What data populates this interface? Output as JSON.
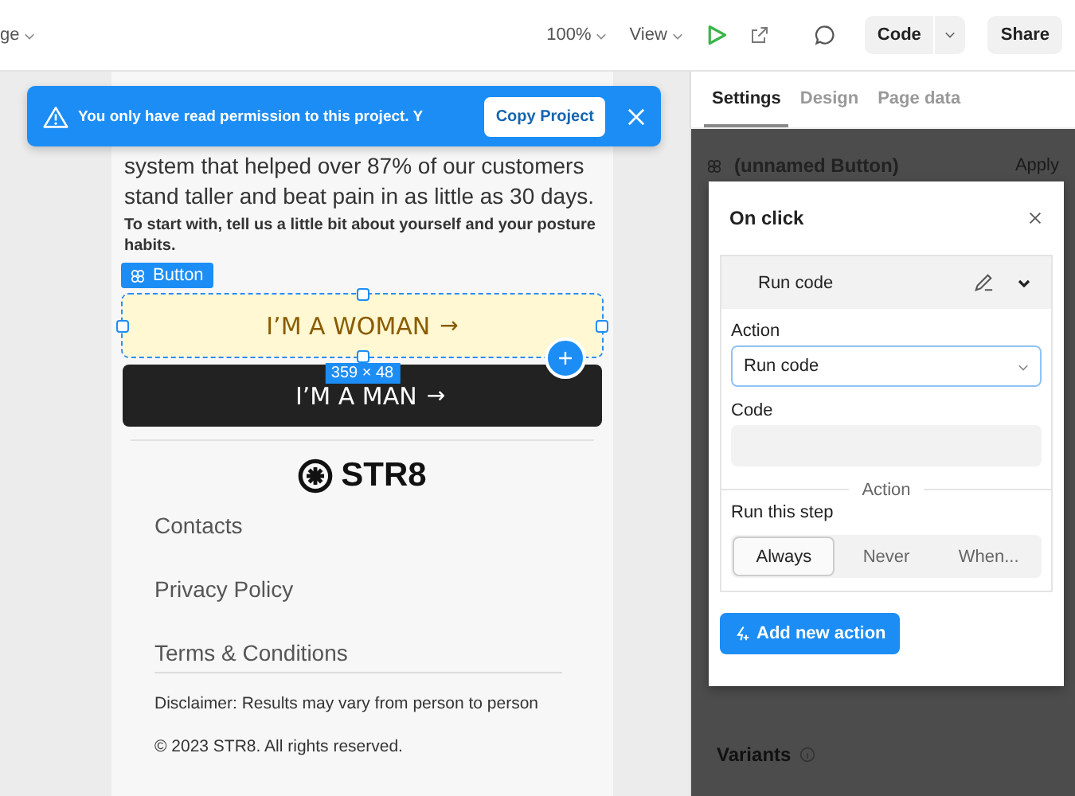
{
  "toolbar": {
    "page_menu": "ge",
    "zoom": "100%",
    "view": "View",
    "code_button": "Code",
    "share_button": "Share"
  },
  "banner": {
    "message": "You only have read permission to this project. Y",
    "action": "Copy Project"
  },
  "canvas": {
    "paragraph": "system that helped over 87% of our customers stand taller and beat pain in as little as 30 days.",
    "prompt": "To start with, tell us a little bit about yourself and your posture habits.",
    "selection_tag": "Button",
    "size_badge": "359 × 48",
    "buttons": [
      {
        "label": "I’M A WOMAN",
        "arrow": "→",
        "kind": "light",
        "selected": true
      },
      {
        "label": "I’M A MAN",
        "arrow": "→",
        "kind": "dark",
        "selected": false
      }
    ],
    "logo": "STR8",
    "links": [
      "Contacts",
      "Privacy Policy",
      "Terms & Conditions"
    ],
    "disclaimer": "Disclaimer: Results may vary from person to person",
    "copyright": "© 2023 STR8. All rights reserved."
  },
  "panel": {
    "tabs": [
      {
        "label": "Settings",
        "selected": true
      },
      {
        "label": "Design",
        "selected": false
      },
      {
        "label": "Page data",
        "selected": false
      }
    ],
    "element_name": "(unnamed Button)",
    "apply": "Apply",
    "variants": "Variants"
  },
  "dialog": {
    "title": "On click",
    "step_title": "Run code",
    "action_label": "Action",
    "action_value": "Run code",
    "code_label": "Code",
    "divider_label": "Action",
    "run_label": "Run this step",
    "run_options": [
      {
        "label": "Always",
        "selected": true
      },
      {
        "label": "Never",
        "selected": false
      },
      {
        "label": "When...",
        "selected": false
      }
    ],
    "add_button": "Add new action"
  }
}
